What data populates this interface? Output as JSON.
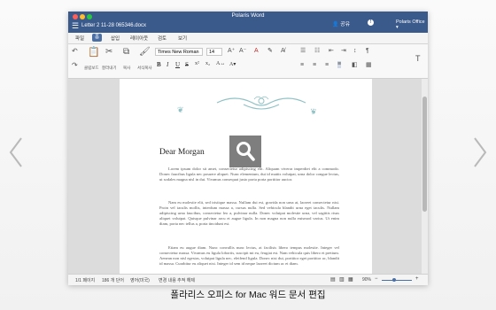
{
  "window": {
    "app_title": "Polaris Word",
    "doc_tab": "Letter 2 11-28 065346.docx",
    "share_label": "공유",
    "office_label": "Polaris Office ▾"
  },
  "tabs": [
    "파일",
    "홈",
    "삽입",
    "레이아웃",
    "검토",
    "보기"
  ],
  "ribbon": {
    "font_name": "Times New Roman",
    "font_size": "14",
    "labels": [
      "클립보드",
      "잘라내기",
      "복사",
      "서식복사"
    ]
  },
  "document": {
    "greeting": "Dear Morgan",
    "paragraphs": [
      "Lorem ipsum dolor sit amet, consectetur adipiscing elit. Aliquam viverra imperdiet elit a commodo. Donec faucibus ligula nec posuere aliquet. Nunc elementum, dui id mattis volutpat, urna dolor congue lectus, ut sodales magna nisl in dui. Vivamus consequat justo porta porta porttitor auctor.",
      "Nam eu molestie elit, sed tristique massa. Nullam dui est, gravida non urna at, laoreet consectetur nisi. Proin vel iaculis mollis, interdum massa a, cursus nulla. Sed vehicula blandit urna eget iaculis. Nullam adipiscing urna faucibus, consectetur leo a, pulvinar nulla. Donec volutpat molestie urna, vel sagittis risus aliquet volutpat. Quisque pulvinar arcu et augue ligula. In non magna non nulla euismod varius. Ut enim diam, porta nec tellus a, porta tincidunt est.",
      "Etiam eu augue diam. Nunc convallis nunc lectus, at facilisis libero tempus molestie. Integer vel consectetur massa. Vivamus eu ligula lobortis, suscipit mi eu, feugiat est. Nam vehicula quis libero et pretium. Aenean non nisl egestas, volutpat ligula nec, eleifend ligula. Donec nisi dui, porttitor eget porttitor ac, blandit id massa. Curabitur eu aliquet nisi. Integer id sem id neque laoreet dictum ac et diam."
    ]
  },
  "status": {
    "page": "1/1 페이지",
    "words": "186 개 단어",
    "language": "영어(미국)",
    "track": "변경 내용 추적 해제",
    "zoom": "90%"
  },
  "caption": "폴라리스 오피스 for Mac 워드 문서 편집",
  "colors": {
    "titlebar": "#3a5a8c",
    "accent": "#4a6fa5",
    "ornament": "#8fc1c5"
  }
}
